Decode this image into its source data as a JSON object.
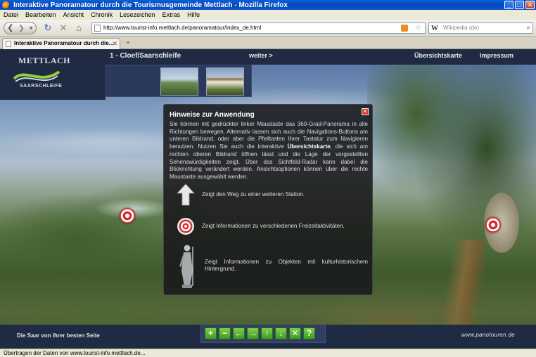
{
  "window": {
    "title": "Interaktive Panoramatour durch die Tourismusgemeinde Mettlach - Mozilla Firefox",
    "controls": [
      "minimize",
      "maximize",
      "close"
    ]
  },
  "menu": [
    "Datei",
    "Bearbeiten",
    "Ansicht",
    "Chronik",
    "Lesezeichen",
    "Extras",
    "Hilfe"
  ],
  "toolbar": {
    "url": "http://www.tourist-info.mettlach.de/panoramatour/index_de.html",
    "search_placeholder": "Wikipedia (de)"
  },
  "tab": {
    "label": "Interaktive Panoramatour durch die..."
  },
  "page": {
    "logo_top": "METTLACH",
    "logo_bottom": "SAARSCHLEIFE",
    "station": "1 - Cloef/Saarschleife",
    "next": "weiter >",
    "overview": "Übersichtskarte",
    "impressum": "Impressum",
    "tagline": "Die Saar von ihrer besten Seite",
    "credit": "www.panotouren.de"
  },
  "dialog": {
    "title": "Hinweise zur Anwendung",
    "text_before_bold": "Sie können mit gedrückter linker Maustaste das 360-Grad-Panorama in alle Richtungen bewegen. Alternativ lassen sich auch die Navigations-Buttons am unteren Bildrand, oder aber die Pfeiltasten Ihrer Tastatur zum Navigieren benutzen. Nutzen Sie auch die interaktive ",
    "bold_text": "Übersichtskarte",
    "text_after_bold": ", die sich am rechten oberen Bildrand öffnen lässt und die Lage der vorgestellten Sehenswürdigkeiten zeigt. Über das Sichtfeld-Radar kann dabei die Blickrichtung verändert werden. Ansichtsoptionen können über die rechte Maustaste ausgewählt werden.",
    "legend": [
      {
        "icon": "arrow-up-icon",
        "text": "Zeigt den Weg zu einer weiteren Station."
      },
      {
        "icon": "target-hotspot-icon",
        "text": "Zeigt Informationen zu verschiedenen Freizeitaktivitäten."
      },
      {
        "icon": "statue-icon",
        "text": "Zeigt Informationen zu Objekten mit kulturhistorischem Hintergrund."
      }
    ]
  },
  "controls": {
    "buttons": [
      "zoom-in",
      "zoom-out",
      "pan-left",
      "pan-right",
      "pan-up",
      "pan-down",
      "fullscreen",
      "help"
    ],
    "glyphs": [
      "+",
      "−",
      "←",
      "→",
      "↑",
      "↓",
      "✕",
      "?"
    ]
  },
  "status": "Übertragen der Daten von www.tourist-info.mettlach.de...",
  "colors": {
    "header_bg": "#1f2a43",
    "control_green": "#4fae28",
    "hotspot_red": "#d23030"
  }
}
